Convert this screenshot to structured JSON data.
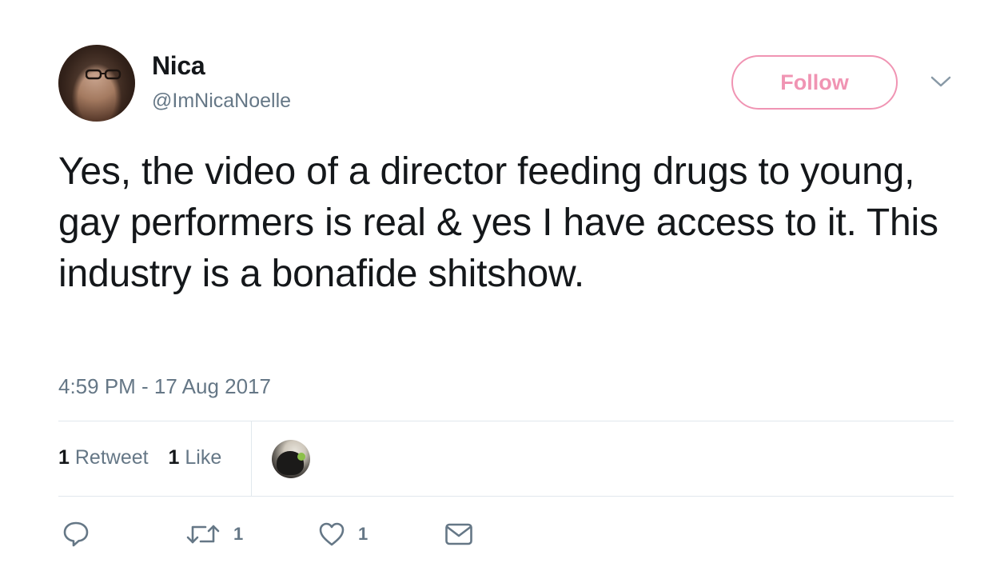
{
  "author": {
    "name": "Nica",
    "handle": "@ImNicaNoelle"
  },
  "follow_button": {
    "label": "Follow"
  },
  "tweet": {
    "text": "Yes, the video of a director feeding drugs to young, gay performers is real & yes I have access to it. This industry is a bonafide shitshow.",
    "timestamp": "4:59 PM - 17 Aug 2017"
  },
  "stats": {
    "retweets_count": "1",
    "retweets_label": "Retweet",
    "likes_count": "1",
    "likes_label": "Like"
  },
  "actions": {
    "reply_icon": "reply-icon",
    "retweet_icon": "retweet-icon",
    "retweet_count": "1",
    "like_icon": "heart-icon",
    "like_count": "1",
    "dm_icon": "envelope-icon"
  },
  "colors": {
    "follow_accent": "#f094b3",
    "muted_text": "#657786",
    "primary_text": "#14171a",
    "divider": "#e1e8ed"
  }
}
